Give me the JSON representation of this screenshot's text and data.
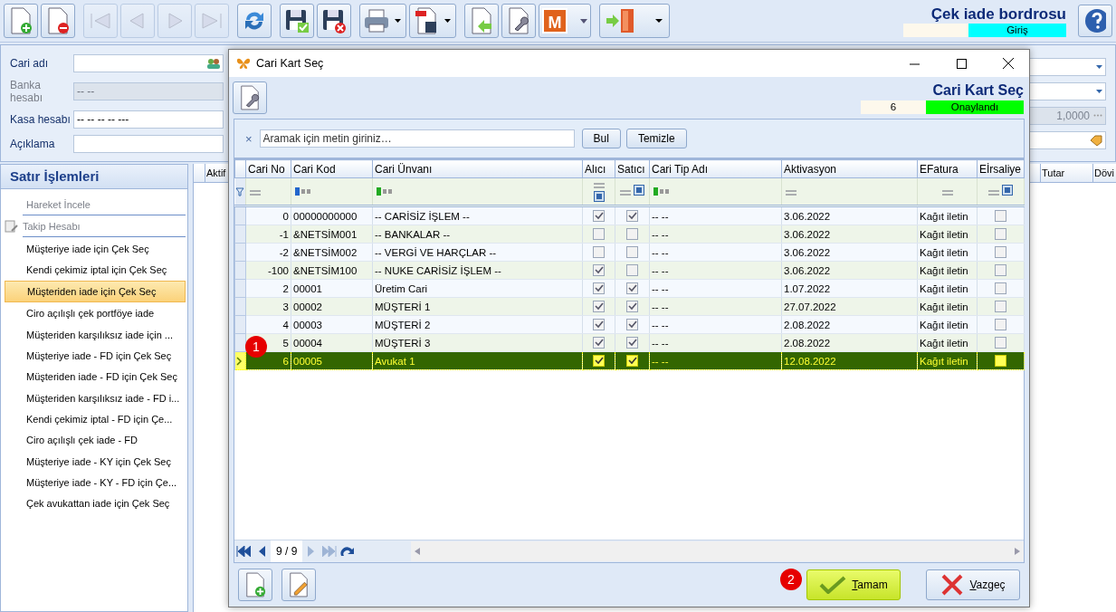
{
  "toolbar": {
    "buttons": [
      {
        "kind": "new",
        "disabled": false
      },
      {
        "kind": "delete",
        "disabled": false
      },
      {
        "kind": "first",
        "disabled": true
      },
      {
        "kind": "prev",
        "disabled": true
      },
      {
        "kind": "next",
        "disabled": true
      },
      {
        "kind": "last",
        "disabled": true
      },
      {
        "kind": "refresh",
        "disabled": false
      },
      {
        "kind": "save",
        "disabled": false
      },
      {
        "kind": "discard",
        "disabled": false
      },
      {
        "kind": "print",
        "disabled": false
      },
      {
        "kind": "pdf",
        "disabled": false
      },
      {
        "kind": "import",
        "disabled": false
      },
      {
        "kind": "tools",
        "disabled": false
      },
      {
        "kind": "module",
        "disabled": false,
        "label": "M"
      },
      {
        "kind": "exit",
        "disabled": false
      }
    ],
    "title": "Çek iade bordrosu",
    "status": "Giriş"
  },
  "form": {
    "fields": [
      {
        "label": "Cari adı",
        "disabled": false
      },
      {
        "label": "Banka hesabı",
        "value": "-- --",
        "disabled": true
      },
      {
        "label": "Kasa hesabı",
        "value": "-- -- -- -- ---",
        "disabled": false
      },
      {
        "label": "Açıklama",
        "disabled": false
      }
    ],
    "right_fields": [
      {
        "kind": "dropdown"
      },
      {
        "kind": "dropdown"
      },
      {
        "kind": "rate",
        "value": "1,0000"
      },
      {
        "kind": "tag"
      }
    ]
  },
  "sidebar": {
    "title": "Satır İşlemleri",
    "items": [
      {
        "label": "Hareket İncele",
        "disabled": true,
        "selected": false
      },
      {
        "label": "Takip Hesabı",
        "disabled": true,
        "selected": false
      },
      {
        "label": "Müşteriye iade için Çek Seç",
        "disabled": false,
        "selected": false
      },
      {
        "label": "Kendi çekimiz iptal için Çek Seç",
        "disabled": false,
        "selected": false
      },
      {
        "label": "Müşteriden iade için Çek Seç",
        "disabled": false,
        "selected": true
      },
      {
        "label": "Ciro açılışlı çek portföye iade",
        "disabled": false,
        "selected": false
      },
      {
        "label": "Müşteriden karşılıksız iade için ...",
        "disabled": false,
        "selected": false
      },
      {
        "label": "Müşteriye iade - FD için Çek Seç",
        "disabled": false,
        "selected": false
      },
      {
        "label": "Müşteriden iade - FD için Çek Seç",
        "disabled": false,
        "selected": false
      },
      {
        "label": "Müşteriden karşılıksız iade - FD i...",
        "disabled": false,
        "selected": false
      },
      {
        "label": "Kendi çekimiz iptal - FD için Çe...",
        "disabled": false,
        "selected": false
      },
      {
        "label": "Ciro açılışlı çek iade - FD",
        "disabled": false,
        "selected": false
      },
      {
        "label": "Müşteriye iade - KY için Çek Seç",
        "disabled": false,
        "selected": false
      },
      {
        "label": "Müşteriye iade - KY - FD için Çe...",
        "disabled": false,
        "selected": false
      },
      {
        "label": "Çek avukattan iade için Çek Seç",
        "disabled": false,
        "selected": false
      }
    ]
  },
  "main_grid": {
    "columns": [
      "Aktif",
      "Tutar",
      "Dövi"
    ]
  },
  "dialog": {
    "title": "Cari Kart Seç",
    "heading": "Cari Kart Seç",
    "record": "6",
    "status": "Onaylandı",
    "search": {
      "placeholder": "Aramak için metin giriniz…",
      "clear": "×",
      "buttons": [
        "Bul",
        "Temizle"
      ]
    },
    "grid": {
      "columns": [
        "Cari No",
        "Cari Kod",
        "Cari Ünvanı",
        "Alıcı",
        "Satıcı",
        "Cari Tip Adı",
        "Aktivasyon",
        "EFatura",
        "Eİrsaliye"
      ],
      "rows": [
        {
          "no": "0",
          "kod": "00000000000",
          "unvan": "-- CARİSİZ İŞLEM --",
          "alici": true,
          "satici": true,
          "tip": "-- --",
          "aktivasyon": "3.06.2022",
          "efatura": "Kağıt iletin",
          "eirsaliye": false,
          "selected": false
        },
        {
          "no": "-1",
          "kod": "&NETSİM001",
          "unvan": "-- BANKALAR --",
          "alici": false,
          "satici": false,
          "tip": "-- --",
          "aktivasyon": "3.06.2022",
          "efatura": "Kağıt iletin",
          "eirsaliye": false,
          "selected": false
        },
        {
          "no": "-2",
          "kod": "&NETSİM002",
          "unvan": "-- VERGİ VE HARÇLAR --",
          "alici": false,
          "satici": false,
          "tip": "-- --",
          "aktivasyon": "3.06.2022",
          "efatura": "Kağıt iletin",
          "eirsaliye": false,
          "selected": false
        },
        {
          "no": "-100",
          "kod": "&NETSİM100",
          "unvan": "-- NUKE CARİSİZ İŞLEM --",
          "alici": true,
          "satici": false,
          "tip": "-- --",
          "aktivasyon": "3.06.2022",
          "efatura": "Kağıt iletin",
          "eirsaliye": false,
          "selected": false
        },
        {
          "no": "2",
          "kod": "00001",
          "unvan": "Üretim Cari",
          "alici": true,
          "satici": true,
          "tip": "-- --",
          "aktivasyon": "1.07.2022",
          "efatura": "Kağıt iletin",
          "eirsaliye": false,
          "selected": false
        },
        {
          "no": "3",
          "kod": "00002",
          "unvan": "MÜŞTERİ 1",
          "alici": true,
          "satici": true,
          "tip": "-- --",
          "aktivasyon": "27.07.2022",
          "efatura": "Kağıt iletin",
          "eirsaliye": false,
          "selected": false
        },
        {
          "no": "4",
          "kod": "00003",
          "unvan": "MÜŞTERİ 2",
          "alici": true,
          "satici": true,
          "tip": "-- --",
          "aktivasyon": "2.08.2022",
          "efatura": "Kağıt iletin",
          "eirsaliye": false,
          "selected": false
        },
        {
          "no": "5",
          "kod": "00004",
          "unvan": "MÜŞTERİ 3",
          "alici": true,
          "satici": true,
          "tip": "-- --",
          "aktivasyon": "2.08.2022",
          "efatura": "Kağıt iletin",
          "eirsaliye": false,
          "selected": false
        },
        {
          "no": "6",
          "kod": "00005",
          "unvan": "Avukat 1",
          "alici": true,
          "satici": true,
          "tip": "-- --",
          "aktivasyon": "12.08.2022",
          "efatura": "Kağıt iletin",
          "eirsaliye": false,
          "selected": true
        }
      ]
    },
    "navigator": {
      "position": "9 / 9",
      "buttons": [
        {
          "kind": "first",
          "disabled": false
        },
        {
          "kind": "prev",
          "disabled": false
        },
        {
          "kind": "next",
          "disabled": true
        },
        {
          "kind": "last",
          "disabled": true
        },
        {
          "kind": "refresh",
          "disabled": false
        }
      ]
    },
    "ok": "Tamam",
    "cancel": "Vazgeç"
  },
  "markers": [
    {
      "label": "1"
    },
    {
      "label": "2"
    }
  ]
}
